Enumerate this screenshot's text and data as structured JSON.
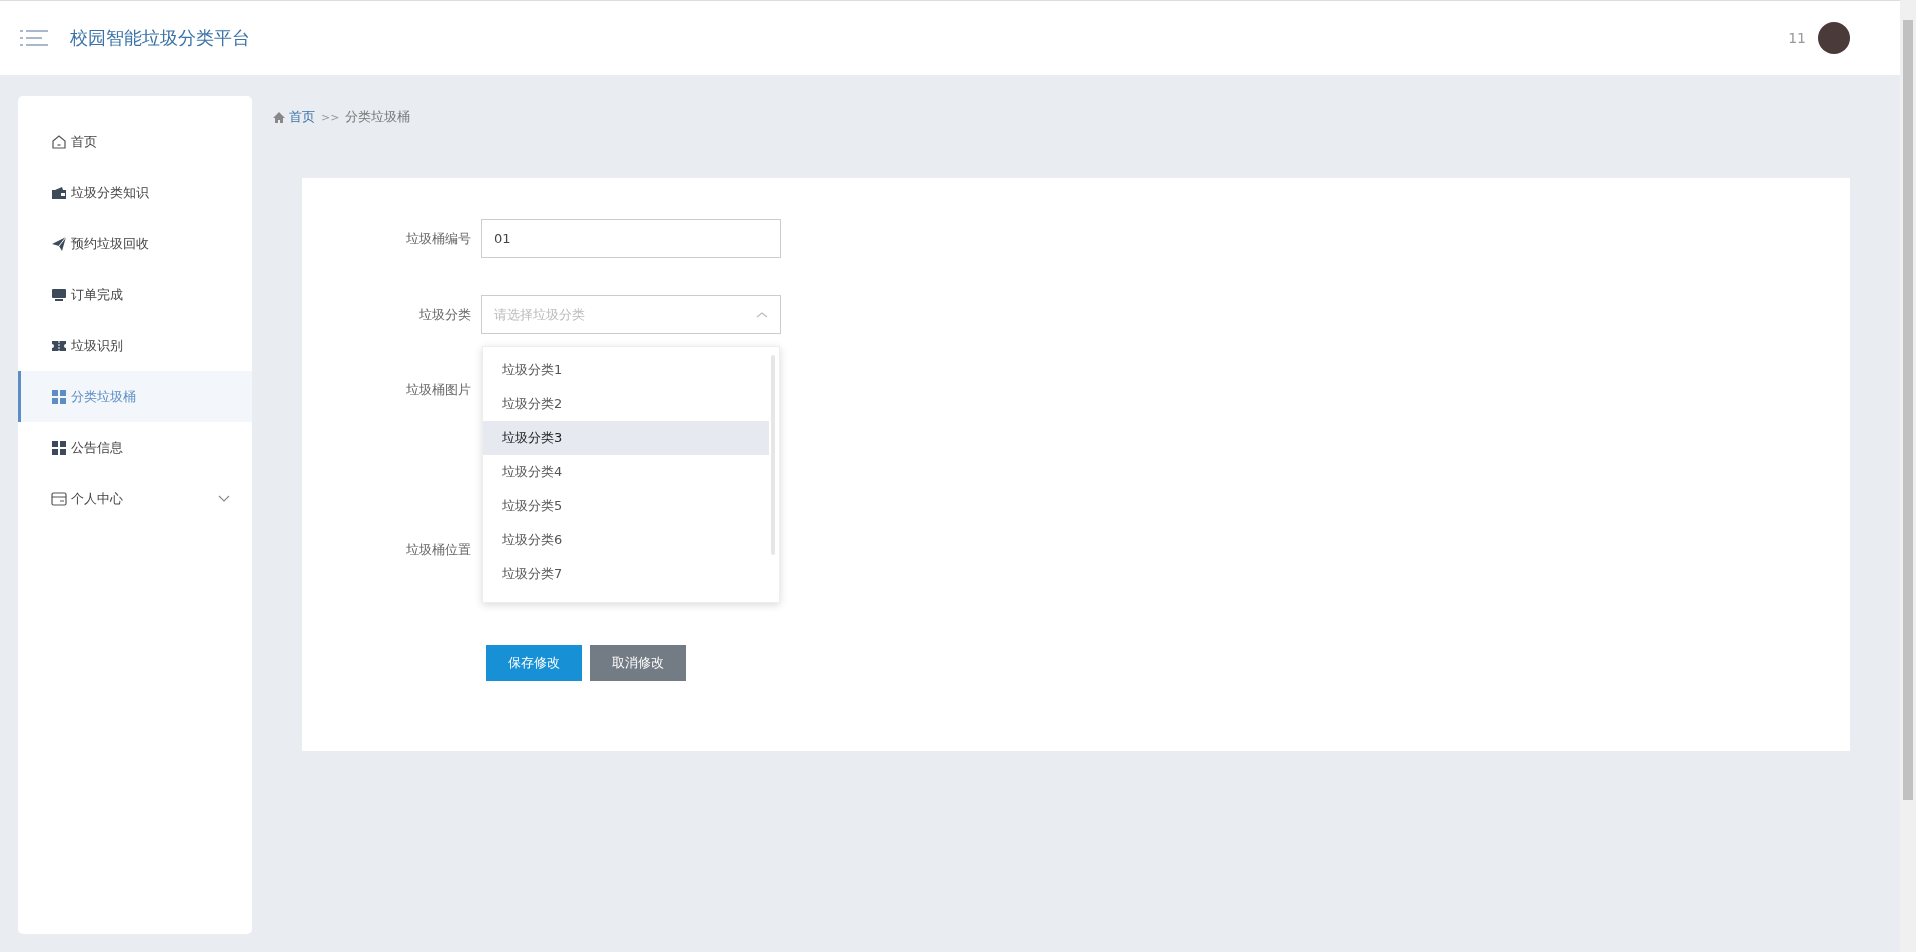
{
  "header": {
    "title": "校园智能垃圾分类平台",
    "user": "11"
  },
  "sidebar": {
    "items": [
      {
        "label": "首页",
        "kind": "home",
        "selected": false
      },
      {
        "label": "垃圾分类知识",
        "kind": "wallet",
        "selected": false
      },
      {
        "label": "预约垃圾回收",
        "kind": "plane",
        "selected": false
      },
      {
        "label": "订单完成",
        "kind": "monitor",
        "selected": false
      },
      {
        "label": "垃圾识别",
        "kind": "ticket",
        "selected": false
      },
      {
        "label": "分类垃圾桶",
        "kind": "grid",
        "selected": true
      },
      {
        "label": "公告信息",
        "kind": "grid",
        "selected": false
      },
      {
        "label": "个人中心",
        "kind": "card",
        "selected": false,
        "expanded": false
      }
    ]
  },
  "breadcrumb": {
    "home": "首页",
    "separator": ">>",
    "current": "分类垃圾桶"
  },
  "form": {
    "fields": [
      {
        "label": "垃圾桶编号",
        "kind": "input",
        "value": "01"
      },
      {
        "label": "垃圾分类",
        "kind": "select",
        "placeholder": "请选择垃圾分类",
        "open": true,
        "options": [
          {
            "label": "垃圾分类1",
            "hovered": false
          },
          {
            "label": "垃圾分类2",
            "hovered": false
          },
          {
            "label": "垃圾分类3",
            "hovered": true
          },
          {
            "label": "垃圾分类4",
            "hovered": false
          },
          {
            "label": "垃圾分类5",
            "hovered": false
          },
          {
            "label": "垃圾分类6",
            "hovered": false
          },
          {
            "label": "垃圾分类7",
            "hovered": false
          }
        ]
      },
      {
        "label": "垃圾桶图片",
        "kind": "image"
      },
      {
        "label": "垃圾桶位置",
        "kind": "location"
      }
    ],
    "buttons": [
      {
        "label": "保存修改",
        "kind": "primary"
      },
      {
        "label": "取消修改",
        "kind": "secondary"
      }
    ]
  }
}
